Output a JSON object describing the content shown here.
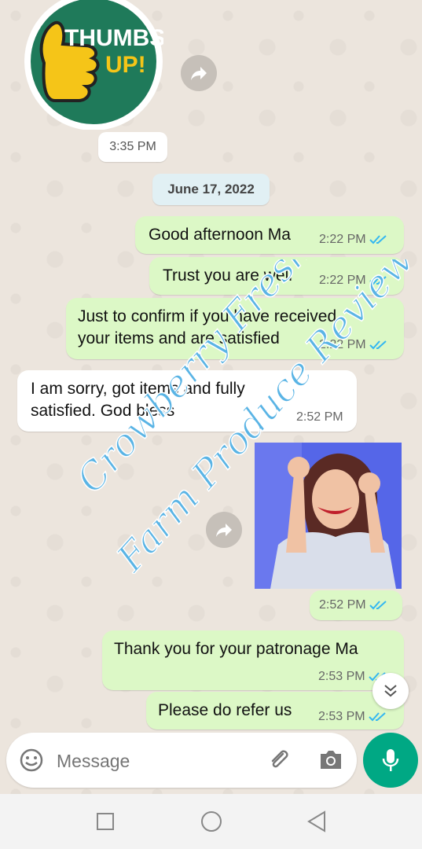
{
  "sticker": {
    "line1": "THUMBS",
    "line2": "UP!"
  },
  "sticker_time": "3:35 PM",
  "date_divider": "June 17, 2022",
  "messages": [
    {
      "text": "Good afternoon Ma",
      "time": "2:22 PM"
    },
    {
      "text": "Trust you are well",
      "time": "2:22 PM"
    },
    {
      "line1": "Just to confirm if you have received",
      "line2": "your items and are satisfied",
      "time": "2:22 PM"
    },
    {
      "line1": "I am sorry, got items and fully",
      "line2": "satisfied. God bless",
      "time": "2:52 PM"
    },
    {
      "time": "2:52 PM"
    },
    {
      "text": "Thank you for your patronage Ma",
      "time": "2:53 PM"
    },
    {
      "text": "Please do refer us",
      "time": "2:53 PM"
    }
  ],
  "watermark": {
    "line1": "Crowberry Fresh",
    "line2": "Farm Produce Review"
  },
  "composer": {
    "placeholder": "Message"
  },
  "colors": {
    "outgoing": "#dcf8c6",
    "incoming": "#ffffff",
    "accent": "#00a884",
    "ticks": "#34b7f1"
  }
}
